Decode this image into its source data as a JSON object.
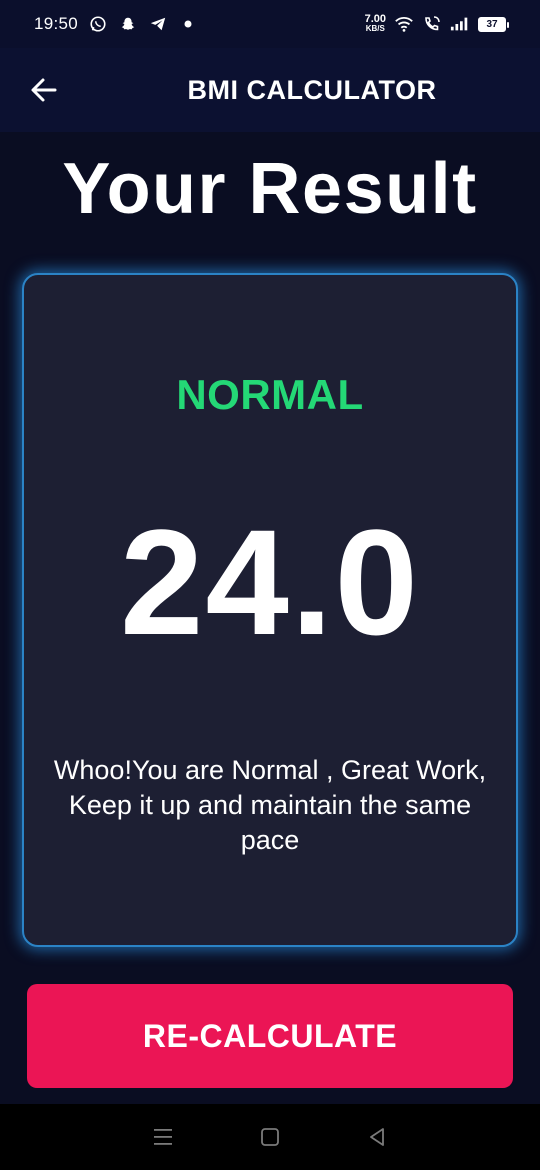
{
  "status_bar": {
    "time": "19:50",
    "notification_icons": [
      "whatsapp-icon",
      "snapchat-icon",
      "telegram-icon",
      "dot-icon"
    ],
    "net_speed_value": "7.00",
    "net_speed_unit": "KB/S",
    "battery_level": "37"
  },
  "app_bar": {
    "title": "BMI CALCULATOR"
  },
  "page": {
    "heading": "Your Result"
  },
  "result": {
    "status": "NORMAL",
    "bmi_value": "24.0",
    "message": "Whoo!You are Normal , Great Work, Keep it up and maintain the same pace"
  },
  "actions": {
    "recalculate_label": "RE-CALCULATE"
  },
  "colors": {
    "background": "#0a0d22",
    "app_bar": "#0c1131",
    "card": "#1d1f33",
    "card_glow": "#2b83c6",
    "status_green": "#24d876",
    "button": "#eb1555"
  }
}
